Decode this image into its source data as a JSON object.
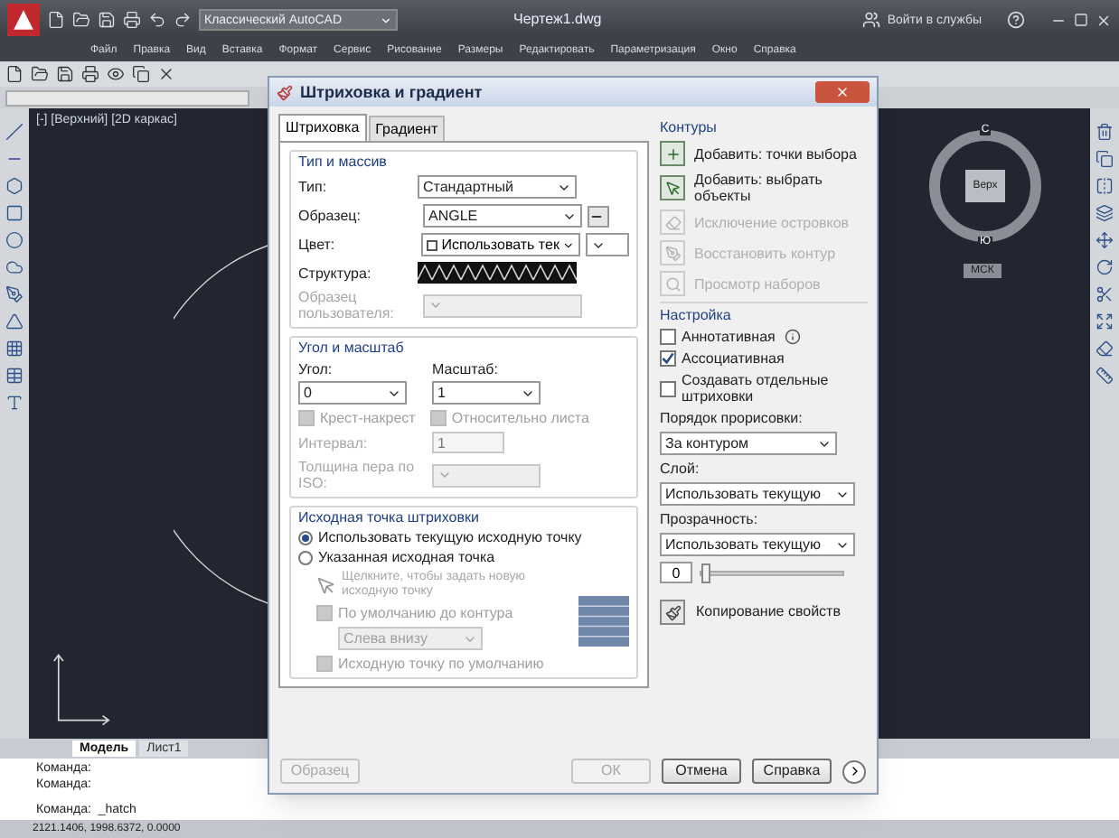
{
  "app": {
    "workspace": "Классический AutoCAD",
    "title": "Чертеж1.dwg",
    "login": "Войти в службы"
  },
  "menu": [
    "Файл",
    "Правка",
    "Вид",
    "Вставка",
    "Формат",
    "Сервис",
    "Рисование",
    "Размеры",
    "Редактировать",
    "Параметризация",
    "Окно",
    "Справка"
  ],
  "viewport": {
    "label": "[-] [Верхний] [2D каркас]"
  },
  "viewcube": {
    "north": "С",
    "south": "Ю",
    "top": "Верх",
    "wcs": "МСК"
  },
  "layout_tabs": [
    {
      "label": "Модель",
      "selected": true
    },
    {
      "label": "Лист1",
      "selected": false
    }
  ],
  "command_lines": [
    "Команда:",
    "Команда:",
    "Команда:  _hatch"
  ],
  "status_bar": {
    "coordinates": "2121.1406, 1998.6372, 0.0000"
  },
  "dialog": {
    "title": "Штриховка и градиент",
    "tabs": [
      {
        "label": "Штриховка",
        "selected": true
      },
      {
        "label": "Градиент",
        "selected": false
      }
    ],
    "type_section": {
      "title": "Тип и массив",
      "type": {
        "label": "Тип:",
        "value": "Стандартный"
      },
      "pattern": {
        "label": "Образец:",
        "value": "ANGLE"
      },
      "color": {
        "label": "Цвет:",
        "value": "Использовать тек"
      },
      "swatch": {
        "label": "Структура:"
      },
      "custom": {
        "label": "Образец пользователя:",
        "disabled": true
      }
    },
    "angle_section": {
      "title": "Угол и масштаб",
      "angle": {
        "label": "Угол:",
        "value": "0"
      },
      "scale": {
        "label": "Масштаб:",
        "value": "1"
      },
      "checks": [
        {
          "label": "Крест-накрест",
          "checked": false,
          "disabled": true
        },
        {
          "label": "Относительно листа",
          "checked": false,
          "disabled": true
        }
      ],
      "spacing": {
        "label": "Интервал:",
        "value": "1",
        "disabled": true
      },
      "iso": {
        "label": "Толщина пера по ISO:",
        "disabled": true
      }
    },
    "origin_section": {
      "title": "Исходная точка штриховки",
      "options": [
        {
          "label": "Использовать текущую исходную точку",
          "selected": true
        },
        {
          "label": "Указанная исходная точка",
          "selected": false
        }
      ],
      "pick_hint": "Щелкните, чтобы задать новую исходную точку",
      "default_check": {
        "label": "По умолчанию до контура",
        "checked": false
      },
      "position": "Слева внизу",
      "store_check": {
        "label": "Исходную точку по умолчанию",
        "checked": false
      }
    },
    "boundaries": {
      "title": "Контуры",
      "actions": [
        {
          "label": "Добавить: точки выбора",
          "disabled": false
        },
        {
          "label": "Добавить: выбрать объекты",
          "disabled": false
        },
        {
          "label": "Исключение островков",
          "disabled": true
        },
        {
          "label": "Восстановить контур",
          "disabled": true
        },
        {
          "label": "Просмотр наборов",
          "disabled": true
        }
      ]
    },
    "options": {
      "title": "Настройка",
      "checks": [
        {
          "label": "Аннотативная",
          "checked": false
        },
        {
          "label": "Ассоциативная",
          "checked": true
        },
        {
          "label": "Создавать отдельные штриховки",
          "checked": false
        }
      ],
      "draw_order": {
        "label": "Порядок прорисовки:",
        "value": "За контуром"
      },
      "layer": {
        "label": "Слой:",
        "value": "Использовать текущую"
      },
      "transparency": {
        "label": "Прозрачность:",
        "value": "Использовать текущую",
        "reading": "0",
        "level": 0.0
      }
    },
    "inherit": "Копирование свойств",
    "buttons": [
      {
        "label": "Образец",
        "disabled": true
      },
      {
        "label": "ОК",
        "disabled": true
      },
      {
        "label": "Отмена",
        "disabled": false
      },
      {
        "label": "Справка",
        "disabled": false
      }
    ]
  }
}
